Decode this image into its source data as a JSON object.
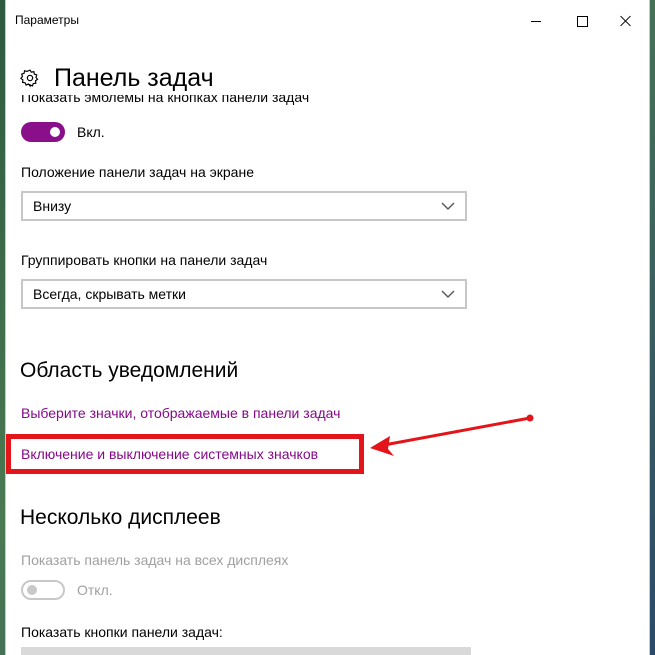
{
  "window": {
    "title": "Параметры",
    "controls": {
      "minimize": "minimize",
      "maximize": "maximize",
      "close": "close"
    }
  },
  "page": {
    "title": "Панель задач",
    "icon": "gear-icon"
  },
  "badges": {
    "label": "Показать эмблемы на кнопках панели задач",
    "toggle_state": "Вкл.",
    "toggle_on": true
  },
  "position": {
    "label": "Положение панели задач на экране",
    "selected": "Внизу"
  },
  "grouping": {
    "label": "Группировать кнопки на панели задач",
    "selected": "Всегда, скрывать метки"
  },
  "notifications": {
    "title": "Область уведомлений",
    "link_select_icons": "Выберите значки, отображаемые в панели задач",
    "link_system_icons": "Включение и выключение системных значков"
  },
  "multi_display": {
    "title": "Несколько дисплеев",
    "show_all_label": "Показать панель задач на всех дисплеях",
    "toggle_state": "Откл.",
    "toggle_on": false,
    "buttons_label": "Показать кнопки панели задач:"
  },
  "colors": {
    "accent": "#8a0f8a",
    "link": "#86088a",
    "annotation": "#e3141a"
  }
}
